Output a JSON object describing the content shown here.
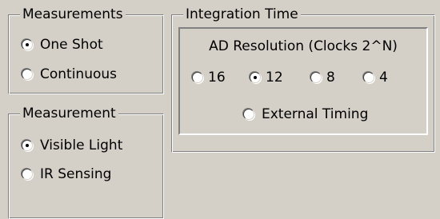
{
  "measurements": {
    "title": "Measurements",
    "options": [
      {
        "label": "One Shot",
        "checked": true
      },
      {
        "label": "Continuous",
        "checked": false
      }
    ]
  },
  "measurement": {
    "title": "Measurement",
    "options": [
      {
        "label": "Visible Light",
        "checked": true
      },
      {
        "label": "IR Sensing",
        "checked": false
      }
    ]
  },
  "integration": {
    "title": "Integration Time",
    "ad_resolution": {
      "label": "AD Resolution (Clocks 2^N)",
      "options": [
        {
          "label": "16",
          "checked": false
        },
        {
          "label": "12",
          "checked": true
        },
        {
          "label": "8",
          "checked": false
        },
        {
          "label": "4",
          "checked": false
        }
      ]
    },
    "external": {
      "label": "External Timing",
      "checked": false
    }
  }
}
